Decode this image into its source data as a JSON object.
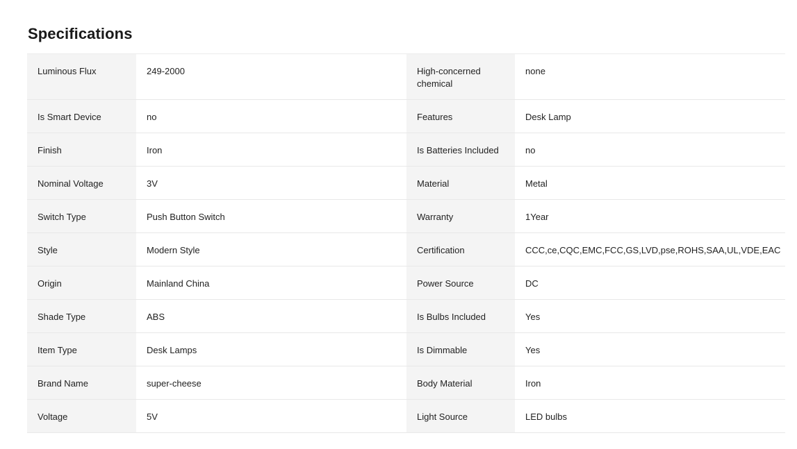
{
  "section": {
    "title": "Specifications"
  },
  "specs": [
    {
      "left_label": "Luminous Flux",
      "left_value": "249-2000",
      "right_label": "High-concerned chemical",
      "right_value": "none"
    },
    {
      "left_label": "Is Smart Device",
      "left_value": "no",
      "right_label": "Features",
      "right_value": "Desk Lamp"
    },
    {
      "left_label": "Finish",
      "left_value": "Iron",
      "right_label": "Is Batteries Included",
      "right_value": "no"
    },
    {
      "left_label": "Nominal Voltage",
      "left_value": "3V",
      "right_label": "Material",
      "right_value": "Metal"
    },
    {
      "left_label": "Switch Type",
      "left_value": "Push Button Switch",
      "right_label": "Warranty",
      "right_value": "1Year"
    },
    {
      "left_label": "Style",
      "left_value": "Modern Style",
      "right_label": "Certification",
      "right_value": "CCC,ce,CQC,EMC,FCC,GS,LVD,pse,ROHS,SAA,UL,VDE,EAC"
    },
    {
      "left_label": "Origin",
      "left_value": "Mainland China",
      "right_label": "Power Source",
      "right_value": "DC"
    },
    {
      "left_label": "Shade Type",
      "left_value": "ABS",
      "right_label": "Is Bulbs Included",
      "right_value": "Yes"
    },
    {
      "left_label": "Item Type",
      "left_value": "Desk Lamps",
      "right_label": "Is Dimmable",
      "right_value": "Yes"
    },
    {
      "left_label": "Brand Name",
      "left_value": "super-cheese",
      "right_label": "Body Material",
      "right_value": "Iron"
    },
    {
      "left_label": "Voltage",
      "left_value": "5V",
      "right_label": "Light Source",
      "right_value": "LED bulbs"
    }
  ]
}
